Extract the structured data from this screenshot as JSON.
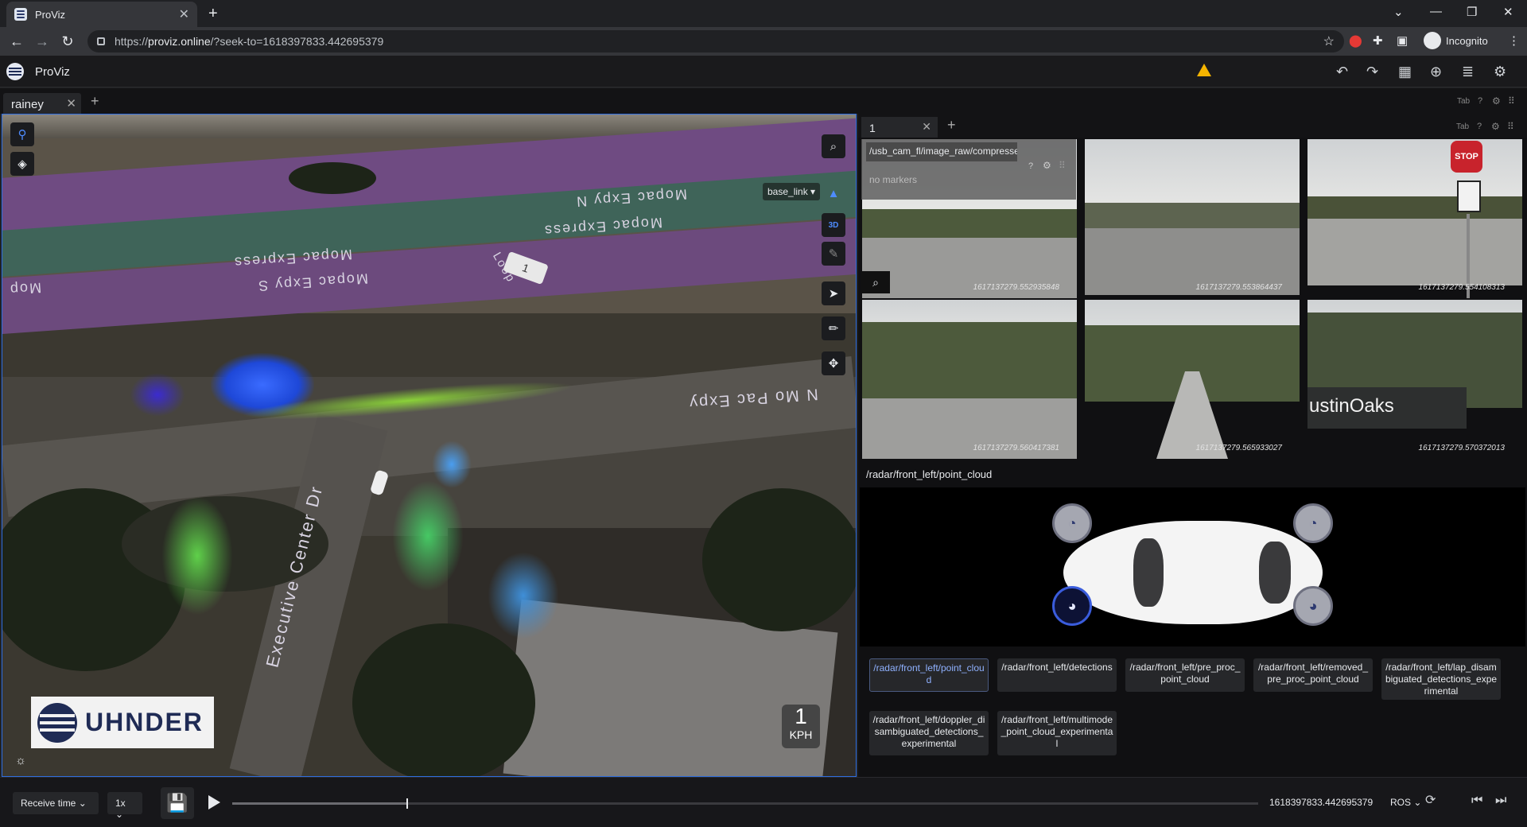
{
  "browser": {
    "tab_title": "ProViz",
    "url_prefix": "https://",
    "url_host": "proviz.online",
    "url_path": "/?seek-to=1618397833.442695379",
    "incognito_label": "Incognito"
  },
  "app": {
    "title": "ProViz",
    "tab_meta": "Tab"
  },
  "workspace": {
    "tab_label": "rainey"
  },
  "panel_3d": {
    "frame_label": "base_link",
    "view_mode": "3D",
    "road_labels": [
      "Mopac Expy N",
      "Mopac Express",
      "Mopac Express",
      "Mopac Expy S",
      "Mop",
      "Loop",
      "1",
      "N Mo Pac Expy",
      "Executive Center Dr"
    ],
    "logo_text": "UHNDER",
    "speed_value": "1",
    "speed_unit": "KPH"
  },
  "right_panel": {
    "subtab_label": "1",
    "tab_meta": "Tab",
    "camera": {
      "topic": "/usb_cam_fl/image_raw/compressed",
      "no_markers": "no markers",
      "timestamps": [
        "1617137279.552935848",
        "1617137279.553864437",
        "1617137279.554108313",
        "1617137279.560417381",
        "1617137279.565933027",
        "1617137279.570372013"
      ],
      "sign_text": "STOP",
      "building_text": "ustinOaks"
    },
    "radar_title": "/radar/front_left/point_cloud",
    "topics": [
      "/radar/front_left/point_cloud",
      "/radar/front_left/detections",
      "/radar/front_left/pre_proc_point_cloud",
      "/radar/front_left/removed_pre_proc_point_cloud",
      "/radar/front_left/lap_disambiguated_detections_experimental",
      "/radar/front_left/doppler_disambiguated_detections_experimental",
      "/radar/front_left/multimode_point_cloud_experimental"
    ]
  },
  "playback": {
    "time_mode": "Receive time",
    "speed": "1x",
    "progress": 0.17,
    "timestamp": "1618397833.442695379",
    "source": "ROS"
  }
}
